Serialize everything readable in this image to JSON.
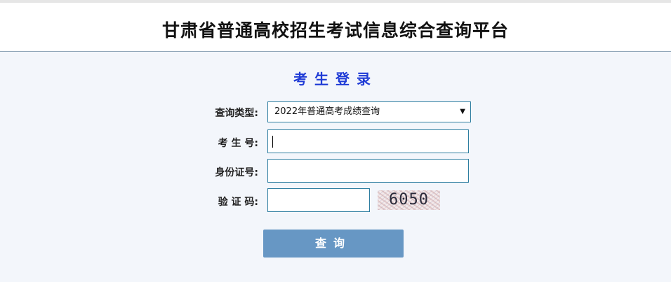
{
  "header": {
    "title": "甘肃省普通高校招生考试信息综合查询平台"
  },
  "login": {
    "title": "考生登录",
    "query_type_label": "查询类型:",
    "query_type_value": "2022年普通高考成绩查询",
    "exam_number_label": "考 生 号:",
    "exam_number_value": "",
    "id_number_label": "身份证号:",
    "id_number_value": "",
    "captcha_label": "验 证 码:",
    "captcha_value": "",
    "captcha_image_text": "6050",
    "submit_label": "查询"
  }
}
